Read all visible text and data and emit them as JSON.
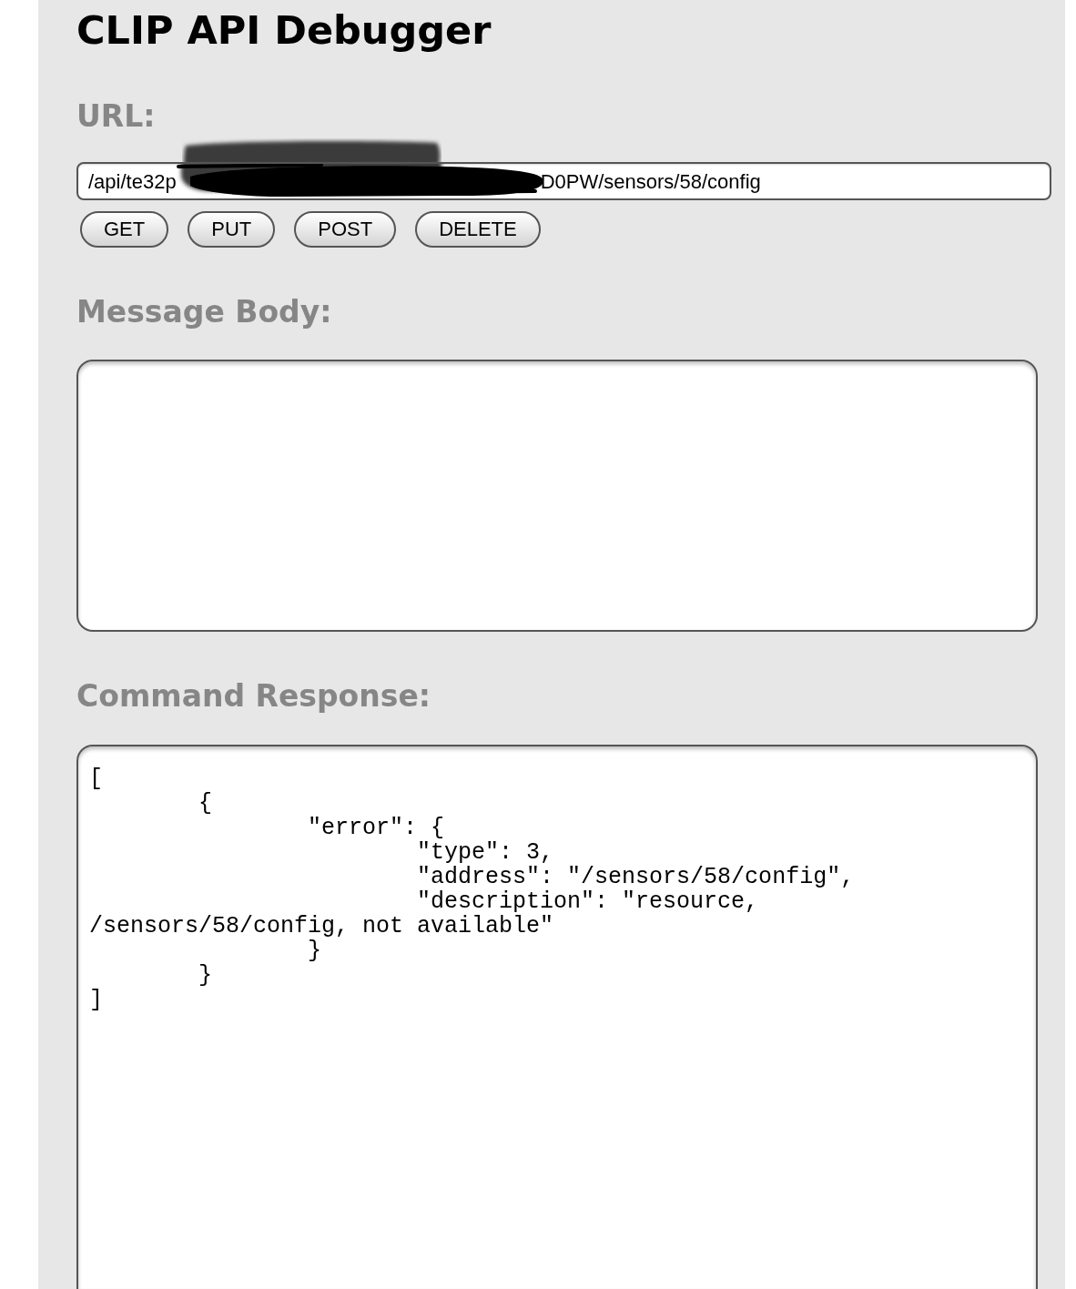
{
  "title": "CLIP API Debugger",
  "url_section": {
    "label": "URL:",
    "field": {
      "value_start": "/api/te32p",
      "value_end": "D0PW/sensors/58/config",
      "redacted": true
    }
  },
  "buttons": [
    "GET",
    "PUT",
    "POST",
    "DELETE"
  ],
  "message_body": {
    "label": "Message Body:"
  },
  "command_response": {
    "label": "Command Response:",
    "text": "[\n\t{\n\t\t\"error\": {\n\t\t\t\"type\": 3,\n\t\t\t\"address\": \"/sensors/58/config\",\n\t\t\t\"description\": \"resource, /sensors/58/config, not available\"\n\t\t}\n\t}\n]"
  }
}
